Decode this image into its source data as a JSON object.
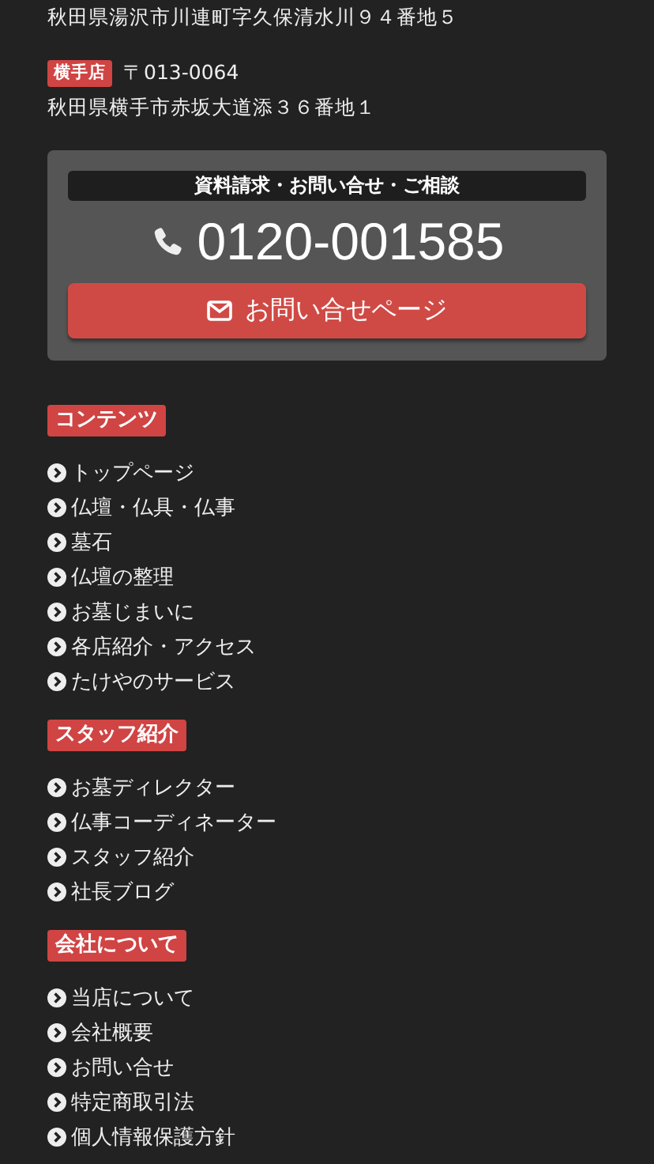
{
  "addresses": [
    {
      "text": "秋田県湯沢市川連町字久保清水川９４番地５"
    },
    {
      "badge": "横手店",
      "postal": "〒013-0064",
      "text": "秋田県横手市赤坂大道添３６番地１"
    }
  ],
  "contact": {
    "heading": "資料請求・お問い合せ・ご相談",
    "phone": "0120-001585",
    "button": "お問い合せページ"
  },
  "sections": [
    {
      "title": "コンテンツ",
      "items": [
        "トップページ",
        "仏壇・仏具・仏事",
        "墓石",
        "仏壇の整理",
        "お墓じまいに",
        "各店紹介・アクセス",
        "たけやのサービス"
      ]
    },
    {
      "title": "スタッフ紹介",
      "items": [
        "お墓ディレクター",
        "仏事コーディネーター",
        "スタッフ紹介",
        "社長ブログ"
      ]
    },
    {
      "title": "会社について",
      "items": [
        "当店について",
        "会社概要",
        "お問い合せ",
        "特定商取引法",
        "個人情報保護方針"
      ]
    }
  ]
}
